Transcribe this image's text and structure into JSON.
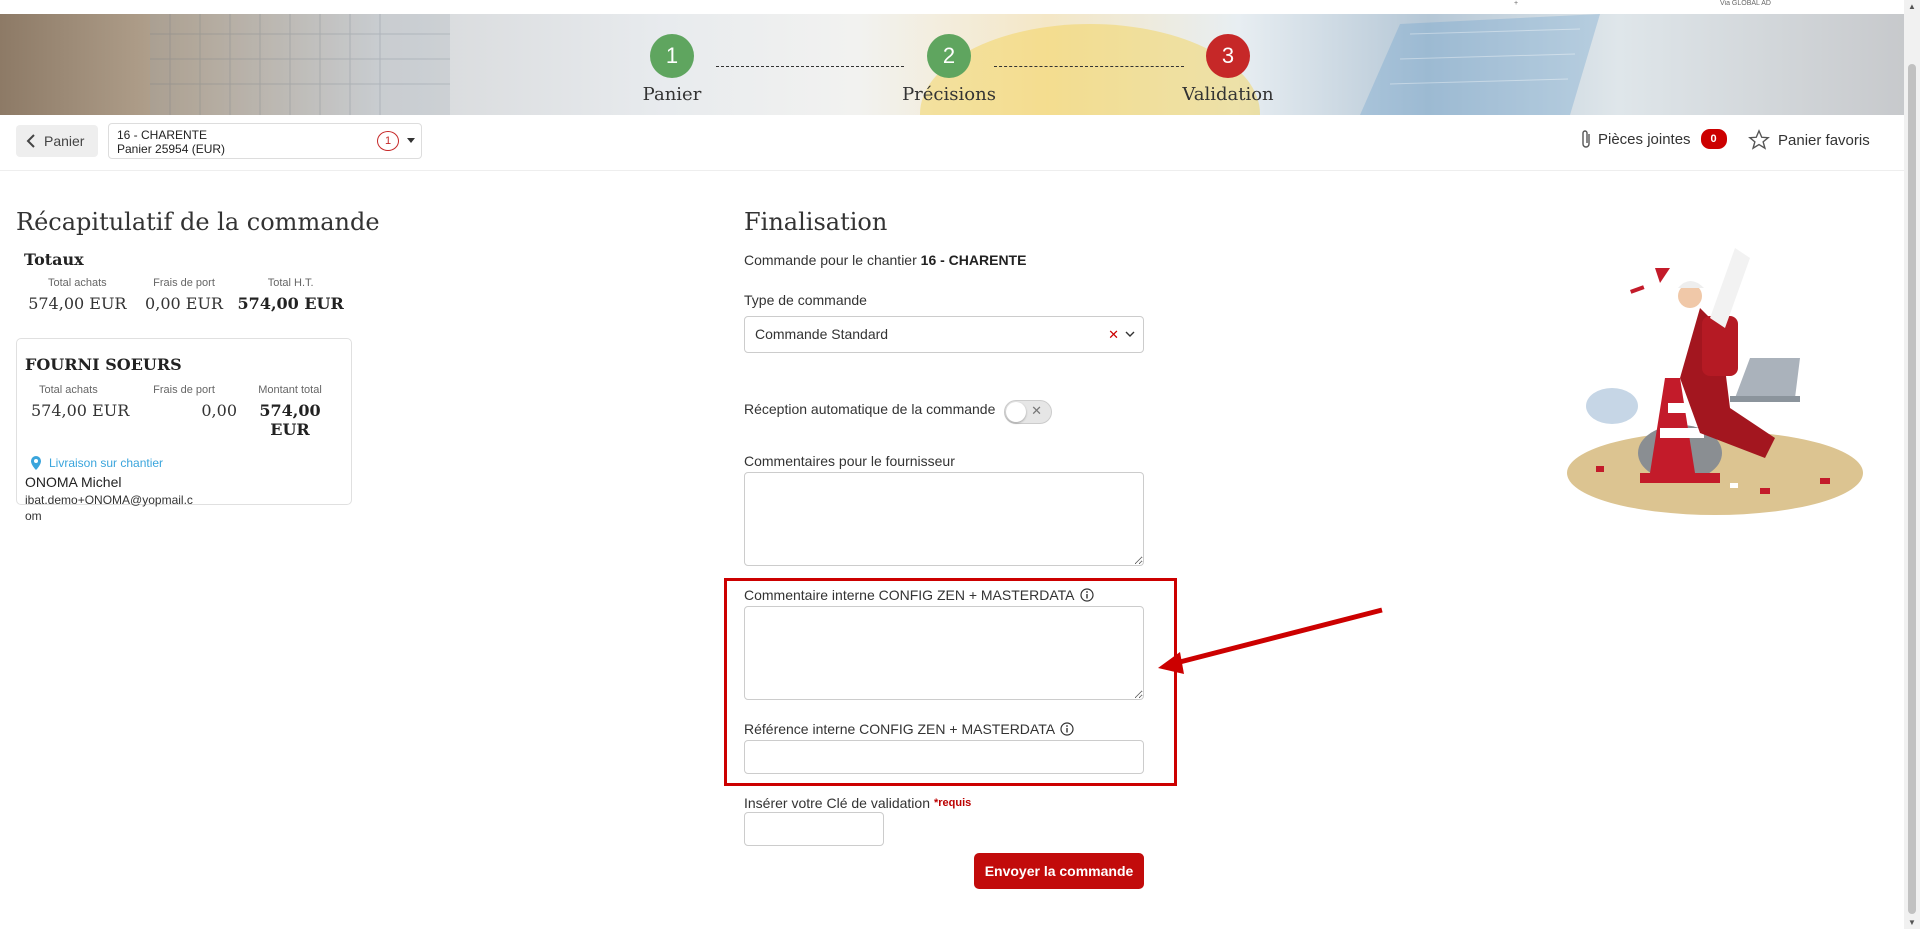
{
  "topstrip": {
    "left_text": "+",
    "right_text": "Via GLOBAL AD"
  },
  "steps": [
    {
      "number": "1",
      "label": "Panier",
      "color": "#5fa55f"
    },
    {
      "number": "2",
      "label": "Précisions",
      "color": "#5fa55f"
    },
    {
      "number": "3",
      "label": "Validation",
      "color": "#c62828"
    }
  ],
  "toolbar": {
    "back_label": "Panier",
    "project_line1": "16 - CHARENTE",
    "project_line2": "Panier 25954 (EUR)",
    "project_badge": "1",
    "attachments_label": "Pièces jointes",
    "attachments_count": "0",
    "favorites_label": "Panier favoris"
  },
  "recap": {
    "title": "Récapitulatif de la commande",
    "totals": {
      "title": "Totaux",
      "cols": [
        {
          "key": "Total achats",
          "value": "574,00 EUR"
        },
        {
          "key": "Frais de port",
          "value": "0,00 EUR"
        },
        {
          "key": "Total H.T.",
          "value": "574,00 EUR"
        }
      ]
    },
    "supplier": {
      "title": "FOURNI SOEURS",
      "cols": [
        {
          "key": "Total achats",
          "value": "574,00 EUR"
        },
        {
          "key": "Frais de port",
          "value": "0,00"
        },
        {
          "key": "Montant total",
          "value": "574,00 EUR"
        }
      ],
      "delivery": "Livraison sur chantier",
      "contact_name": "ONOMA Michel",
      "contact_email": "ibat.demo+ONOMA@yopmail.com"
    }
  },
  "finalisation": {
    "title": "Finalisation",
    "chantier_prefix": "Commande pour le chantier",
    "chantier_name": "16 - CHARENTE",
    "type_label": "Type de commande",
    "type_value": "Commande Standard",
    "auto_reception_label": "Réception automatique de la commande",
    "auto_reception_on": false,
    "supplier_comment_label": "Commentaires pour le fournisseur",
    "internal_comment_label": "Commentaire interne CONFIG ZEN + MASTERDATA",
    "internal_ref_label": "Référence interne CONFIG ZEN + MASTERDATA",
    "validation_key_label": "Insérer votre Clé de validation",
    "required_label": "*requis",
    "send_label": "Envoyer la commande"
  },
  "colors": {
    "accent": "#c20b0b",
    "success": "#5fa55f",
    "link": "#3aa5dc"
  }
}
